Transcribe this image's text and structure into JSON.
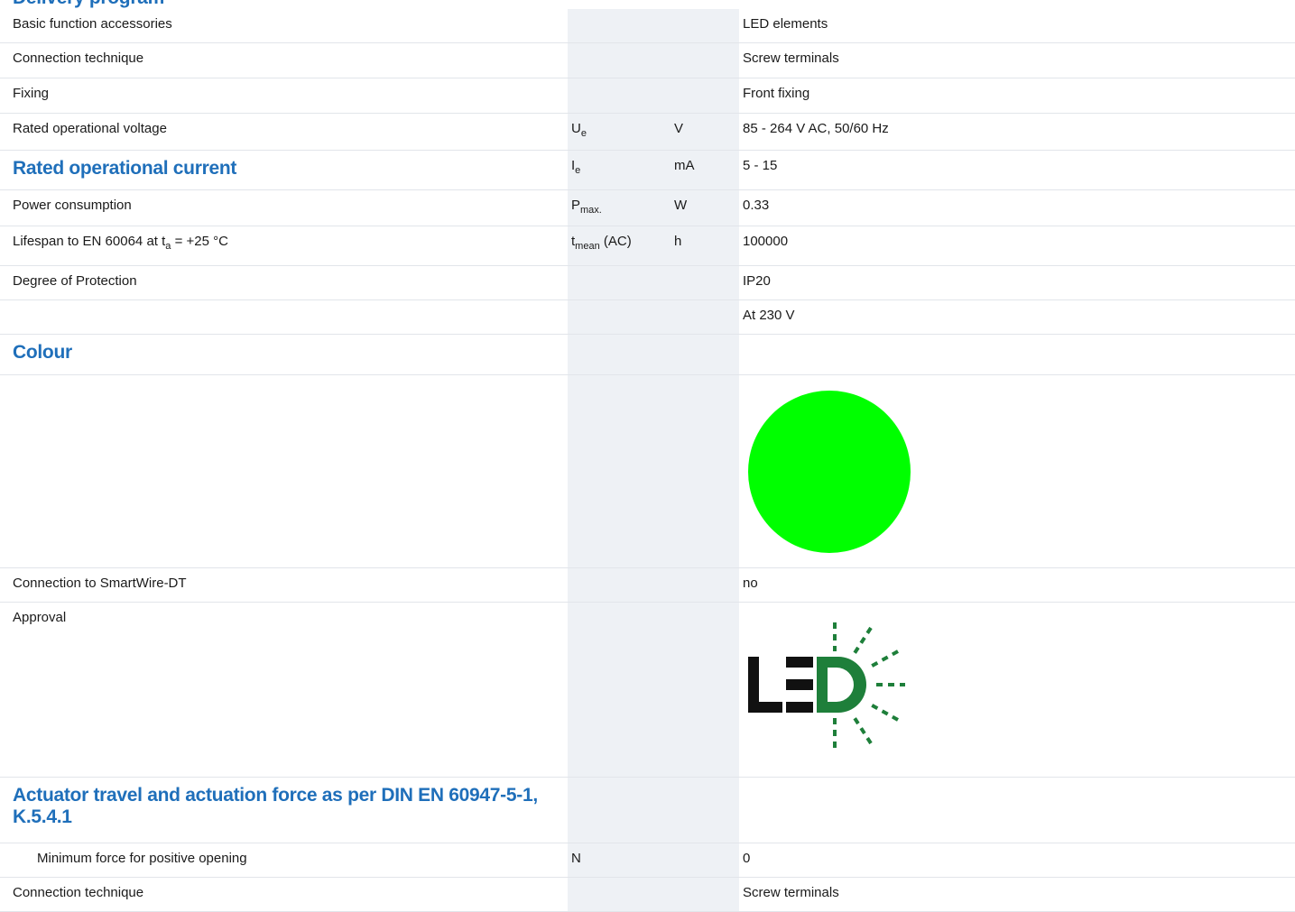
{
  "header": {
    "title": "Delivery program"
  },
  "rows": {
    "basic_function": {
      "label": "Basic function accessories",
      "value": "LED elements"
    },
    "connection1": {
      "label": "Connection technique",
      "value": "Screw terminals"
    },
    "fixing": {
      "label": "Fixing",
      "value": "Front fixing"
    },
    "voltage": {
      "label": "Rated operational voltage",
      "symbol": "U",
      "symbol_sub": "e",
      "unit": "V",
      "value": "85 - 264 V AC, 50/60 Hz"
    },
    "current": {
      "label": "Rated operational current",
      "symbol": "I",
      "symbol_sub": "e",
      "unit": "mA",
      "value": "5 - 15"
    },
    "power": {
      "label": "Power consumption",
      "symbol": "P",
      "symbol_sub": "max.",
      "unit": "W",
      "value": "0.33"
    },
    "lifespan": {
      "label_pre": "Lifespan to EN 60064 at t",
      "label_sub": "a",
      "label_post": " = +25 °C",
      "symbol": "t",
      "symbol_sub": "mean",
      "symbol_post": " (AC)",
      "unit": "h",
      "value": "100000"
    },
    "protection": {
      "label": "Degree of Protection",
      "value": "IP20"
    },
    "note": {
      "value": "At 230 V"
    },
    "colour": {
      "label": "Colour",
      "swatch_color": "#00ff00"
    },
    "smartwire": {
      "label": "Connection to SmartWire-DT",
      "value": "no"
    },
    "approval": {
      "label": "Approval",
      "logo_text": "LED",
      "logo_color": "#1e7f3a"
    },
    "actuator": {
      "label": "Actuator travel and actuation force as per DIN EN 60947-5-1, K.5.4.1"
    },
    "min_force": {
      "label": "Minimum force for positive opening",
      "unit": "N",
      "value": "0"
    },
    "connection2": {
      "label": "Connection technique",
      "value": "Screw terminals"
    }
  }
}
